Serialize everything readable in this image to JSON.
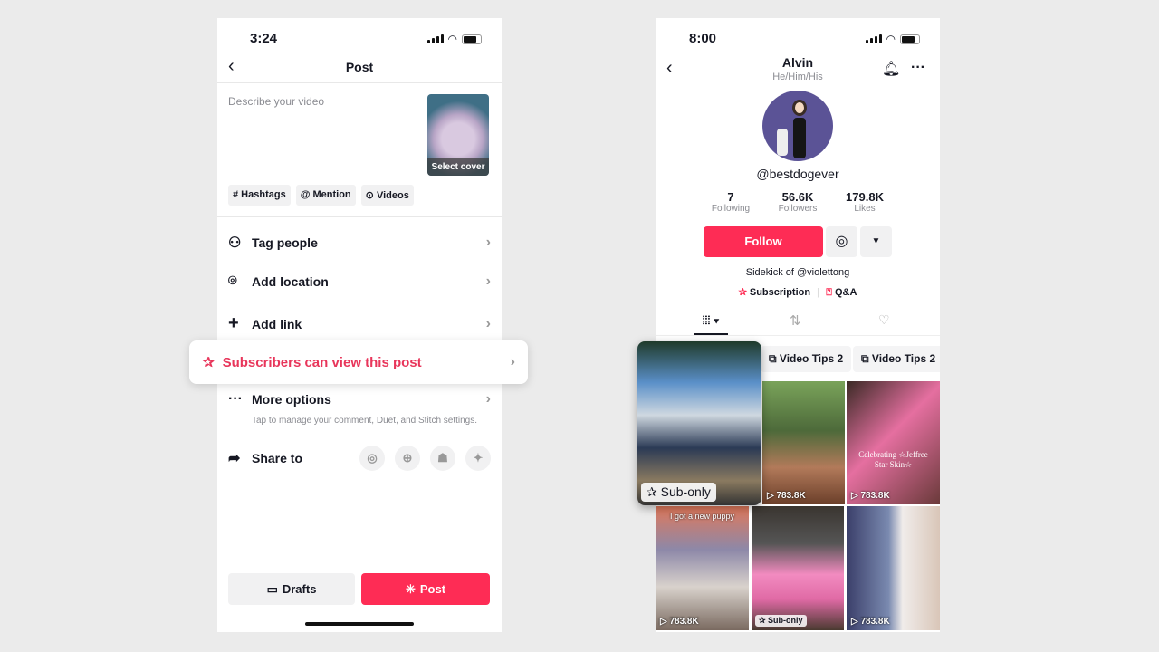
{
  "post_screen": {
    "status_time": "3:24",
    "title": "Post",
    "description_placeholder": "Describe your video",
    "select_cover": "Select cover",
    "chips": [
      "# Hashtags",
      "@ Mention",
      "Videos"
    ],
    "options": [
      {
        "label": "Tag people",
        "icon": "person-icon"
      },
      {
        "label": "Add location",
        "icon": "location-pin-icon"
      },
      {
        "label": "Add link",
        "icon": "plus-icon"
      }
    ],
    "subscribers_option": "Subscribers can view this post",
    "more_options": "More options",
    "more_options_sub": "Tap to manage your comment, Duet, and Stitch settings.",
    "share_to": "Share to",
    "share_targets": [
      "instagram-icon",
      "add-story-icon",
      "snapchat-icon",
      "twitter-icon"
    ],
    "drafts": "Drafts",
    "post": "Post"
  },
  "profile_screen": {
    "status_time": "8:00",
    "name": "Alvin",
    "pronouns": "He/Him/His",
    "username": "@bestdogever",
    "stats": [
      {
        "value": "7",
        "label": "Following"
      },
      {
        "value": "56.6K",
        "label": "Followers"
      },
      {
        "value": "179.8K",
        "label": "Likes"
      }
    ],
    "follow": "Follow",
    "bio": "Sidekick of @violettong",
    "links": [
      "Subscription",
      "Q&A"
    ],
    "playlists": [
      "Video Tips 2",
      "Video Tips 2"
    ],
    "sub_only": "Sub-only",
    "videos": [
      {
        "views": "783.8K",
        "caption": ""
      },
      {
        "views": "783.8K",
        "caption": "Celebrating ☆Jeffree Star Skin☆"
      },
      {
        "views": "783.8K",
        "caption": "I got a new puppy"
      },
      {
        "views": "",
        "caption": "",
        "badge": "Sub-only"
      },
      {
        "views": "783.8K",
        "caption": ""
      }
    ]
  },
  "colors": {
    "accent": "#fe2c55",
    "background": "#ebebeb"
  }
}
